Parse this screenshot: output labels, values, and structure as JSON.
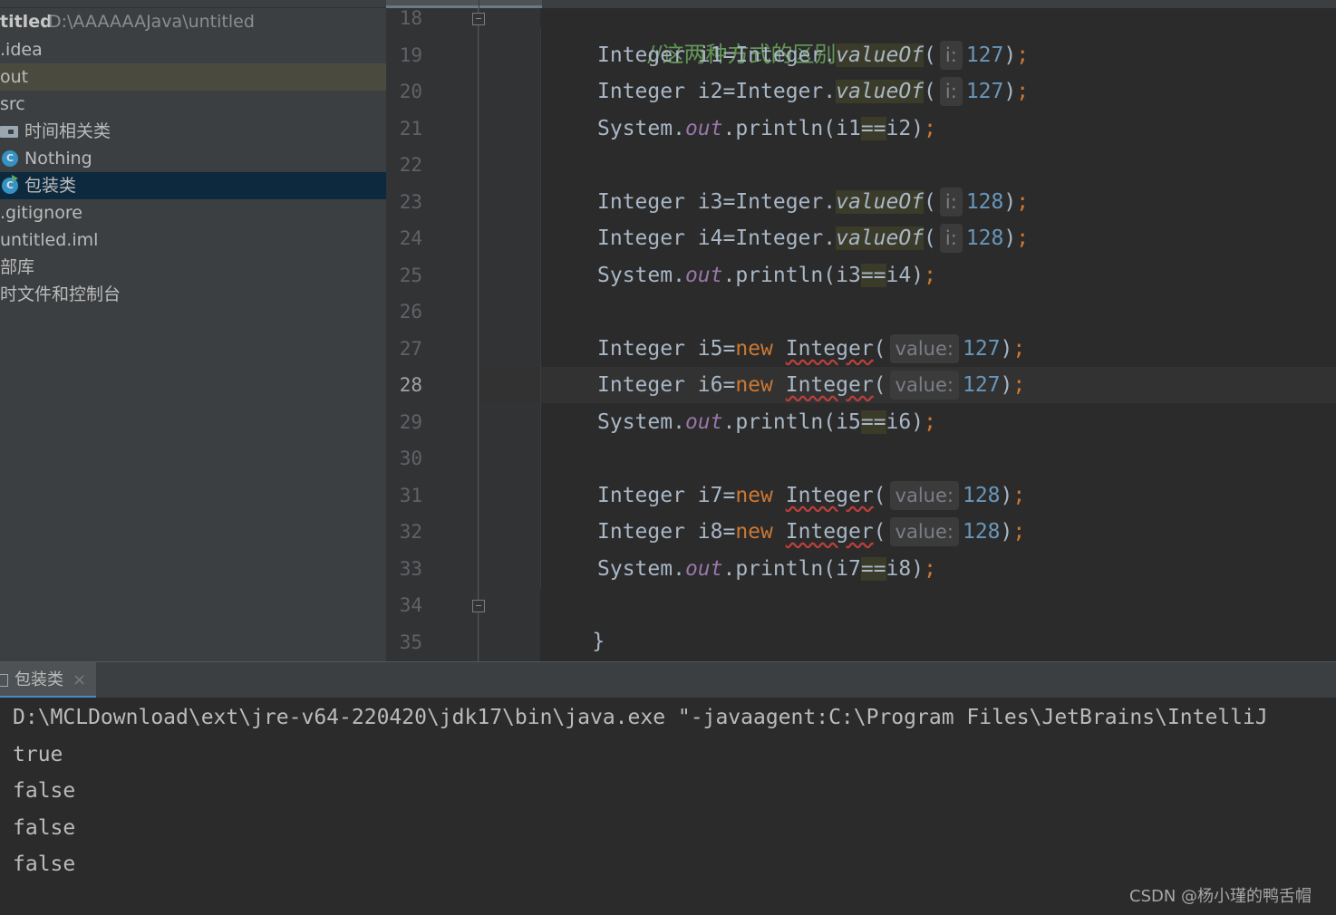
{
  "project": {
    "root_name": "titled",
    "root_path": "D:\\AAAAAAJava\\untitled",
    "items": [
      {
        "label": ".idea"
      },
      {
        "label": "out"
      },
      {
        "label": "src"
      },
      {
        "label": "时间相关类"
      },
      {
        "label": "Nothing"
      },
      {
        "label": "包装类"
      },
      {
        "label": ".gitignore"
      },
      {
        "label": "untitled.iml"
      },
      {
        "label": "部库"
      },
      {
        "label": "时文件和控制台"
      }
    ]
  },
  "editor": {
    "line_numbers": [
      "18",
      "19",
      "20",
      "21",
      "22",
      "23",
      "24",
      "25",
      "26",
      "27",
      "28",
      "29",
      "30",
      "31",
      "32",
      "33",
      "34",
      "35"
    ],
    "current_line": "28",
    "comment": "//这两种方式的区别",
    "hint_i": "i:",
    "hint_value": "value:",
    "lines": {
      "l19": {
        "pre": "Integer i1=Integer.",
        "method": "valueOf",
        "open": "(",
        "num": "127",
        "close": ")",
        "semi": ";"
      },
      "l20": {
        "pre": "Integer i2=Integer.",
        "method": "valueOf",
        "open": "(",
        "num": "127",
        "close": ")",
        "semi": ";"
      },
      "l21": {
        "pre": "System.",
        "field": "out",
        "mid": ".println(i1",
        "op": "==",
        "post": "i2)",
        "semi": ";"
      },
      "l23": {
        "pre": "Integer i3=Integer.",
        "method": "valueOf",
        "open": "(",
        "num": "128",
        "close": ")",
        "semi": ";"
      },
      "l24": {
        "pre": "Integer i4=Integer.",
        "method": "valueOf",
        "open": "(",
        "num": "128",
        "close": ")",
        "semi": ";"
      },
      "l25": {
        "pre": "System.",
        "field": "out",
        "mid": ".println(i3",
        "op": "==",
        "post": "i4)",
        "semi": ";"
      },
      "l27": {
        "pre": "Integer i5=",
        "kw": "new",
        "ctor": "Integer",
        "open": "(",
        "num": "127",
        "close": ")",
        "semi": ";"
      },
      "l28": {
        "pre": "Integer i6=",
        "kw": "new",
        "ctor": "Integer",
        "open": "(",
        "num": "127",
        "close": ")",
        "semi": ";"
      },
      "l29": {
        "pre": "System.",
        "field": "out",
        "mid": ".println(i5",
        "op": "==",
        "post": "i6)",
        "semi": ";"
      },
      "l31": {
        "pre": "Integer i7=",
        "kw": "new",
        "ctor": "Integer",
        "open": "(",
        "num": "128",
        "close": ")",
        "semi": ";"
      },
      "l32": {
        "pre": "Integer i8=",
        "kw": "new",
        "ctor": "Integer",
        "open": "(",
        "num": "128",
        "close": ")",
        "semi": ";"
      },
      "l33": {
        "pre": "System.",
        "field": "out",
        "mid": ".println(i7",
        "op": "==",
        "post": "i8)",
        "semi": ";"
      },
      "l34": "}",
      "l35": "}"
    }
  },
  "run": {
    "tab_label": "包装类",
    "tab_close": "×",
    "command": "D:\\MCLDownload\\ext\\jre-v64-220420\\jdk17\\bin\\java.exe \"-javaagent:C:\\Program Files\\JetBrains\\IntelliJ",
    "output": [
      "true",
      "false",
      "false",
      "false"
    ]
  },
  "watermark": "CSDN @杨小瑾的鸭舌帽",
  "colors": {
    "panel_bg": "#3c3f41",
    "editor_bg": "#2b2b2b",
    "selection": "#0d293e",
    "keyword": "#cc7832",
    "number": "#6897bb",
    "comment": "#629755",
    "static_field": "#9876aa"
  },
  "icons": {
    "folder": "folder-icon",
    "class": "class-icon",
    "run_badge": "run-badge-icon",
    "fold": "fold-marker-icon",
    "console_tab": "console-tab-icon",
    "close": "close-icon"
  }
}
